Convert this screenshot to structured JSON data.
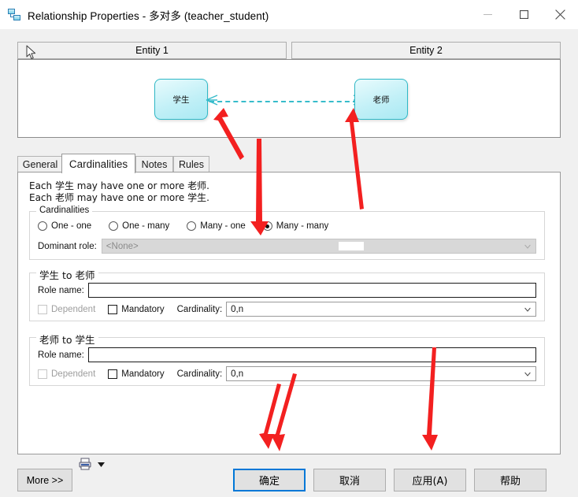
{
  "window": {
    "title": "Relationship Properties - 多对多 (teacher_student)",
    "icon": "relationship-icon",
    "controls": {
      "minimize": "—",
      "maximize": "☐",
      "close": "✕"
    }
  },
  "entity_headers": [
    {
      "label": "Entity 1"
    },
    {
      "label": "Entity 2"
    }
  ],
  "diagram": {
    "left_entity": "学生",
    "right_entity": "老师",
    "relation_style": "dashed",
    "notation": "crow-foot many-to-many"
  },
  "tabs": [
    {
      "label": "General",
      "active": false
    },
    {
      "label": "Cardinalities",
      "active": true
    },
    {
      "label": "Notes",
      "active": false
    },
    {
      "label": "Rules",
      "active": false
    }
  ],
  "description": {
    "line1": "Each 学生 may have one or more 老师.",
    "line2": "Each 老师 may have one or more 学生."
  },
  "cardinalities": {
    "group_title": "Cardinalities",
    "options": [
      {
        "label": "One - one",
        "selected": false
      },
      {
        "label": "One - many",
        "selected": false
      },
      {
        "label": "Many - one",
        "selected": false
      },
      {
        "label": "Many - many",
        "selected": true
      }
    ],
    "dominant_role": {
      "label": "Dominant role:",
      "value": "<None>",
      "enabled": false
    }
  },
  "role_forward": {
    "group_title": "学生 to 老师",
    "role_name_label": "Role name:",
    "role_name_value": "",
    "dependent": {
      "label": "Dependent",
      "checked": false,
      "enabled": false
    },
    "mandatory": {
      "label": "Mandatory",
      "checked": false,
      "enabled": true
    },
    "cardinality_label": "Cardinality:",
    "cardinality_value": "0,n"
  },
  "role_reverse": {
    "group_title": "老师 to 学生",
    "role_name_label": "Role name:",
    "role_name_value": "",
    "dependent": {
      "label": "Dependent",
      "checked": false,
      "enabled": false
    },
    "mandatory": {
      "label": "Mandatory",
      "checked": false,
      "enabled": true
    },
    "cardinality_label": "Cardinality:",
    "cardinality_value": "0,n"
  },
  "footer": {
    "more_label": "More >>",
    "print_icon": "printer-icon",
    "print_dropdown_icon": "chevron-down-icon",
    "ok_label": "确定",
    "cancel_label": "取消",
    "apply_label": "应用(A)",
    "help_label": "帮助",
    "focused_button": "确定"
  },
  "colors": {
    "accent": "#0078d7",
    "entity_border": "#2fb8c6",
    "entity_fill": "#c2f0f7",
    "annotation_red": "#f32020",
    "dialog_bg": "#f0f0f0",
    "button_bg": "#e1e1e1"
  },
  "annotations": {
    "type": "red-arrows",
    "count": 6,
    "targets": [
      "left-crow-foot",
      "right-crow-foot",
      "many-many-radio",
      "reverse-role-group",
      "ok-button",
      "apply-button"
    ]
  }
}
